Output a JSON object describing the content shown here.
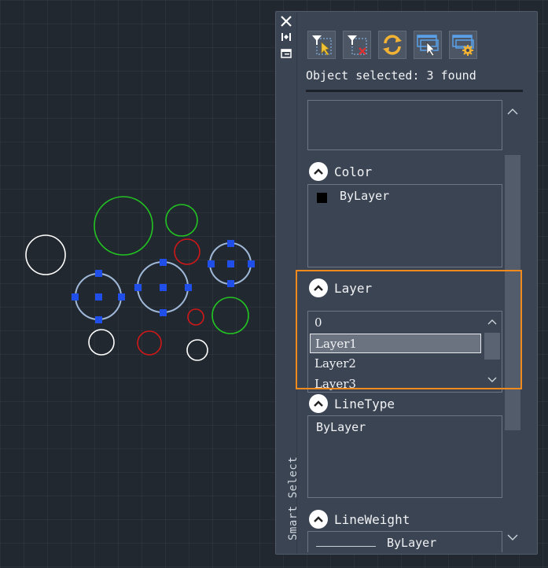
{
  "panel": {
    "title": "Smart Select",
    "status_text": "Object selected: 3 found"
  },
  "toolbar": [
    {
      "name": "select-by-filter-icon"
    },
    {
      "name": "remove-filter-icon"
    },
    {
      "name": "refresh-icon"
    },
    {
      "name": "select-objects-icon"
    },
    {
      "name": "select-settings-icon"
    }
  ],
  "sections": {
    "color": {
      "title": "Color",
      "items": [
        "ByLayer"
      ]
    },
    "layer": {
      "title": "Layer",
      "items": [
        "0",
        "Layer1",
        "Layer2",
        "Layer3"
      ],
      "selected": "Layer1"
    },
    "linetype": {
      "title": "LineType",
      "items": [
        "ByLayer"
      ]
    },
    "lineweight": {
      "title": "LineWeight",
      "items": [
        "ByLayer"
      ]
    }
  },
  "colors": {
    "accent": "#f08a1c",
    "grip": "#1f4fe8",
    "selected_circle": "#9fb8d8",
    "green": "#22c422",
    "red": "#d01818",
    "white": "#ffffff"
  }
}
